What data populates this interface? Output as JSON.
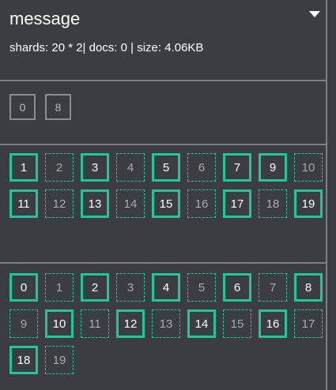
{
  "index": {
    "name": "message",
    "meta": "shards: 20 * 2| docs: 0 | size: 4.06KB"
  },
  "node_row": [
    "0",
    "8"
  ],
  "groups": [
    {
      "shards": [
        {
          "label": "1",
          "type": "primary"
        },
        {
          "label": "2",
          "type": "replica"
        },
        {
          "label": "3",
          "type": "primary"
        },
        {
          "label": "4",
          "type": "replica"
        },
        {
          "label": "5",
          "type": "primary"
        },
        {
          "label": "6",
          "type": "replica"
        },
        {
          "label": "7",
          "type": "primary"
        },
        {
          "label": "9",
          "type": "primary"
        },
        {
          "label": "10",
          "type": "replica"
        },
        {
          "label": "11",
          "type": "primary"
        },
        {
          "label": "12",
          "type": "replica"
        },
        {
          "label": "13",
          "type": "primary"
        },
        {
          "label": "14",
          "type": "replica"
        },
        {
          "label": "15",
          "type": "primary"
        },
        {
          "label": "16",
          "type": "replica"
        },
        {
          "label": "17",
          "type": "primary"
        },
        {
          "label": "18",
          "type": "replica"
        },
        {
          "label": "19",
          "type": "primary"
        }
      ]
    },
    {
      "shards": [
        {
          "label": "0",
          "type": "primary"
        },
        {
          "label": "1",
          "type": "replica"
        },
        {
          "label": "2",
          "type": "primary"
        },
        {
          "label": "3",
          "type": "replica"
        },
        {
          "label": "4",
          "type": "primary"
        },
        {
          "label": "5",
          "type": "replica"
        },
        {
          "label": "6",
          "type": "primary"
        },
        {
          "label": "7",
          "type": "replica"
        },
        {
          "label": "8",
          "type": "primary"
        },
        {
          "label": "9",
          "type": "replica"
        },
        {
          "label": "10",
          "type": "primary"
        },
        {
          "label": "11",
          "type": "replica"
        },
        {
          "label": "12",
          "type": "primary"
        },
        {
          "label": "13",
          "type": "replica"
        },
        {
          "label": "14",
          "type": "primary"
        },
        {
          "label": "15",
          "type": "replica"
        },
        {
          "label": "16",
          "type": "primary"
        },
        {
          "label": "17",
          "type": "replica"
        },
        {
          "label": "18",
          "type": "primary"
        },
        {
          "label": "19",
          "type": "replica"
        }
      ]
    }
  ],
  "colors": {
    "accent": "#22c597",
    "background": "#3a3d41",
    "divider": "#7b7e82"
  },
  "icons": {
    "menu": "caret-down-icon"
  }
}
